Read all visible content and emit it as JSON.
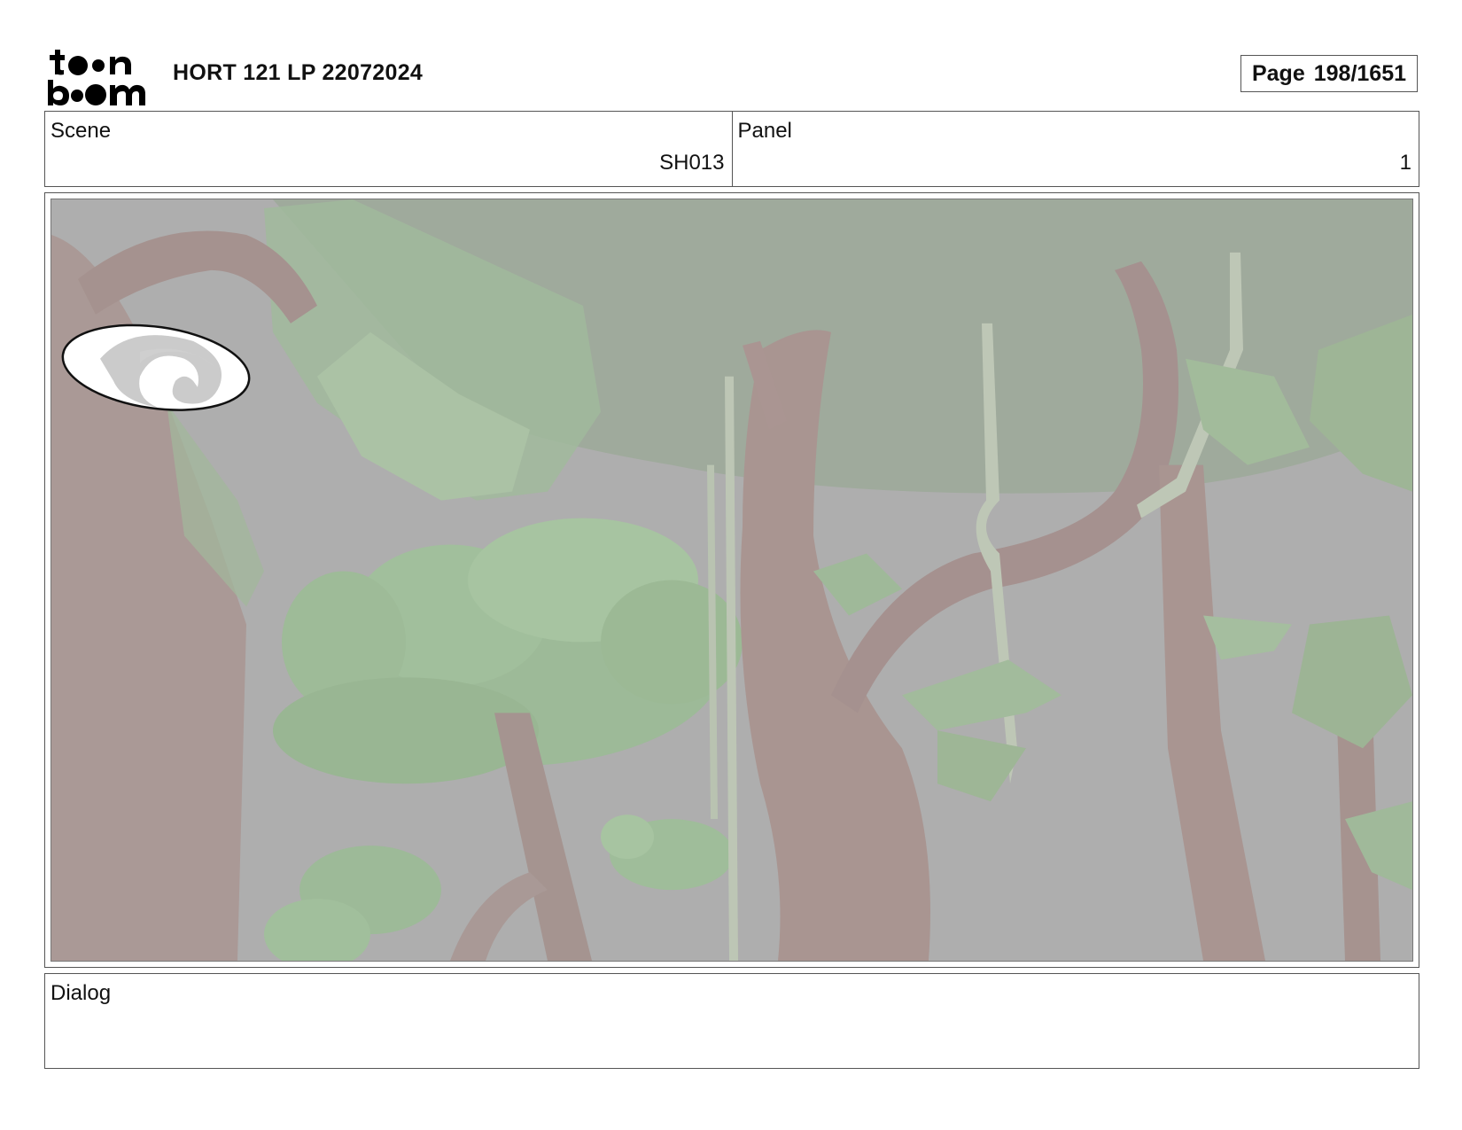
{
  "header": {
    "logo_text_top": "toon",
    "logo_text_bottom": "boom",
    "project_title": "HORT 121 LP 22072024",
    "page_label": "Page",
    "page_value": "198/1651"
  },
  "scene": {
    "label": "Scene",
    "value": "SH013"
  },
  "panel": {
    "label": "Panel",
    "value": "1"
  },
  "frame": {
    "icon": "swirl-portal-icon"
  },
  "dialog": {
    "label": "Dialog",
    "text": ""
  },
  "colors": {
    "background_grey": "#a9a9a9",
    "foliage_green": "#9bb796",
    "bark_brown": "#a48f8b",
    "vine_pale": "#bac4b2",
    "border": "#555555"
  }
}
